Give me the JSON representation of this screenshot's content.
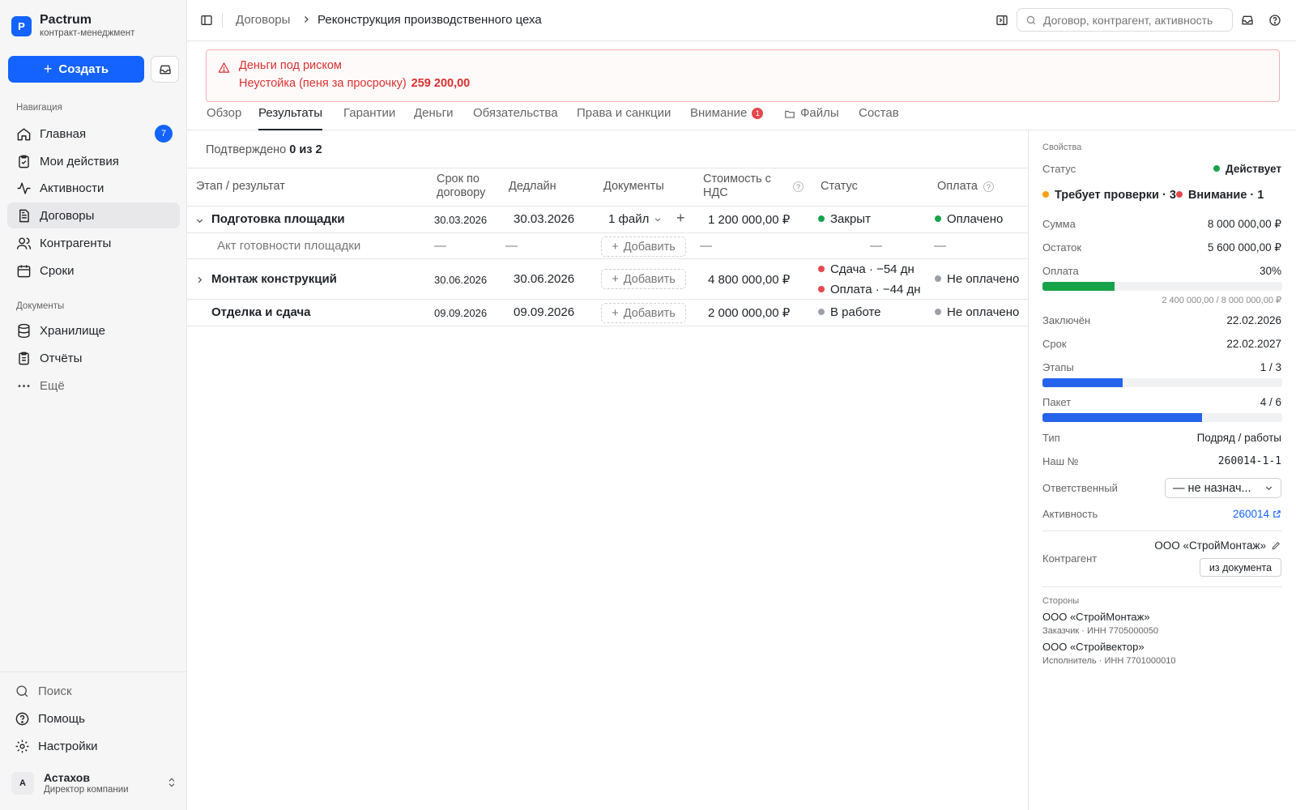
{
  "brand": {
    "logo_letter": "P",
    "name": "Pactrum",
    "subtitle": "контракт-менеджмент"
  },
  "sidebar": {
    "create_label": "Создать",
    "nav_section": "Навигация",
    "nav": [
      {
        "label": "Главная",
        "icon": "home-icon",
        "badge": "7"
      },
      {
        "label": "Мои действия",
        "icon": "clipboard-check-icon"
      },
      {
        "label": "Активности",
        "icon": "activity-icon"
      },
      {
        "label": "Договоры",
        "icon": "document-icon",
        "active": true
      },
      {
        "label": "Контрагенты",
        "icon": "users-icon"
      },
      {
        "label": "Сроки",
        "icon": "calendar-icon"
      }
    ],
    "docs_section": "Документы",
    "docs": [
      {
        "label": "Хранилище",
        "icon": "database-icon"
      },
      {
        "label": "Отчёты",
        "icon": "report-icon"
      },
      {
        "label": "Ещё",
        "icon": "more-icon"
      }
    ],
    "bottom": [
      {
        "label": "Поиск",
        "icon": "search-icon"
      },
      {
        "label": "Помощь",
        "icon": "help-icon"
      },
      {
        "label": "Настройки",
        "icon": "gear-icon"
      }
    ],
    "user": {
      "initial": "А",
      "name": "Астахов",
      "role": "Директор компании"
    }
  },
  "topbar": {
    "breadcrumb_parent": "Договоры",
    "breadcrumb_current": "Реконструкция производственного цеха",
    "search_placeholder": "Договор, контрагент, активность"
  },
  "alert": {
    "title": "Деньги под риском",
    "text": "Неустойка (пеня за просрочку)",
    "amount": "259 200,00"
  },
  "tabs": [
    {
      "label": "Обзор"
    },
    {
      "label": "Результаты",
      "active": true
    },
    {
      "label": "Гарантии"
    },
    {
      "label": "Деньги"
    },
    {
      "label": "Обязательства"
    },
    {
      "label": "Права и санкции"
    },
    {
      "label": "Внимание",
      "badge": "1"
    },
    {
      "label": "Файлы",
      "icon": "folder-icon"
    },
    {
      "label": "Состав"
    }
  ],
  "results": {
    "summary_label": "Подтверждено",
    "summary_value": "0 из 2",
    "columns": {
      "stage": "Этап / результат",
      "term": "Срок по договору",
      "deadline": "Дедлайн",
      "documents": "Документы",
      "cost": "Стоимость с НДС",
      "status": "Статус",
      "payment": "Оплата"
    },
    "help_mark": "?",
    "add_label": "Добавить",
    "rows": [
      {
        "name": "Подготовка площадки",
        "term": "30.03.2026",
        "deadline": "30.03.2026",
        "docs": "1 файл",
        "cost": "1 200 000,00 ₽",
        "status": "Закрыт",
        "payment": "Оплачено"
      },
      {
        "name": "Акт готовности площадки",
        "term": "—",
        "deadline": "—",
        "cost": "—",
        "status": "—",
        "payment": "—"
      },
      {
        "name": "Монтаж конструкций",
        "term": "30.06.2026",
        "deadline": "30.06.2026",
        "cost": "4 800 000,00 ₽",
        "status_1": "Сдача · −54 дн",
        "status_2": "Оплата · −44 дн",
        "payment": "Не оплачено"
      },
      {
        "name": "Отделка и сдача",
        "term": "09.09.2026",
        "deadline": "09.09.2026",
        "cost": "2 000 000,00 ₽",
        "status": "В работе",
        "payment": "Не оплачено"
      }
    ]
  },
  "properties": {
    "section": "Свойства",
    "status_label": "Статус",
    "status_value": "Действует",
    "flag_review": "Требует проверки · 3",
    "flag_attention": "Внимание · 1",
    "sum_label": "Сумма",
    "sum_value": "8 000 000,00 ₽",
    "rest_label": "Остаток",
    "rest_value": "5 600 000,00 ₽",
    "pay_label": "Оплата",
    "pay_value": "30%",
    "pay_fraction": 0.3,
    "pay_detail": "2 400 000,00 / 8 000 000,00 ₽",
    "concluded_label": "Заключён",
    "concluded_value": "22.02.2026",
    "term_label": "Срок",
    "term_value": "22.02.2027",
    "stages_label": "Этапы",
    "stages_value": "1 / 3",
    "stages_fraction": 0.333,
    "package_label": "Пакет",
    "package_value": "4 / 6",
    "package_fraction": 0.667,
    "type_label": "Тип",
    "type_value": "Подряд / работы",
    "our_no_label": "Наш №",
    "our_no_value": "260014-1-1",
    "resp_label": "Ответственный",
    "resp_value": "— не назнач...",
    "activity_label": "Активность",
    "activity_value": "260014",
    "counterparty_label": "Контрагент",
    "counterparty_value": "ООО «СтройМонтаж»",
    "from_doc": "из документа",
    "parties_section": "Стороны",
    "parties": [
      {
        "name": "ООО «СтройМонтаж»",
        "detail": "Заказчик · ИНН 7705000050"
      },
      {
        "name": "ООО «Стройвектор»",
        "detail": "Исполнитель · ИНН 7701000010"
      }
    ],
    "colors": {
      "accent": "#1463ff",
      "pay_bar": "#16a34a",
      "progress_bar": "#2563eb",
      "danger": "#d93030"
    }
  }
}
